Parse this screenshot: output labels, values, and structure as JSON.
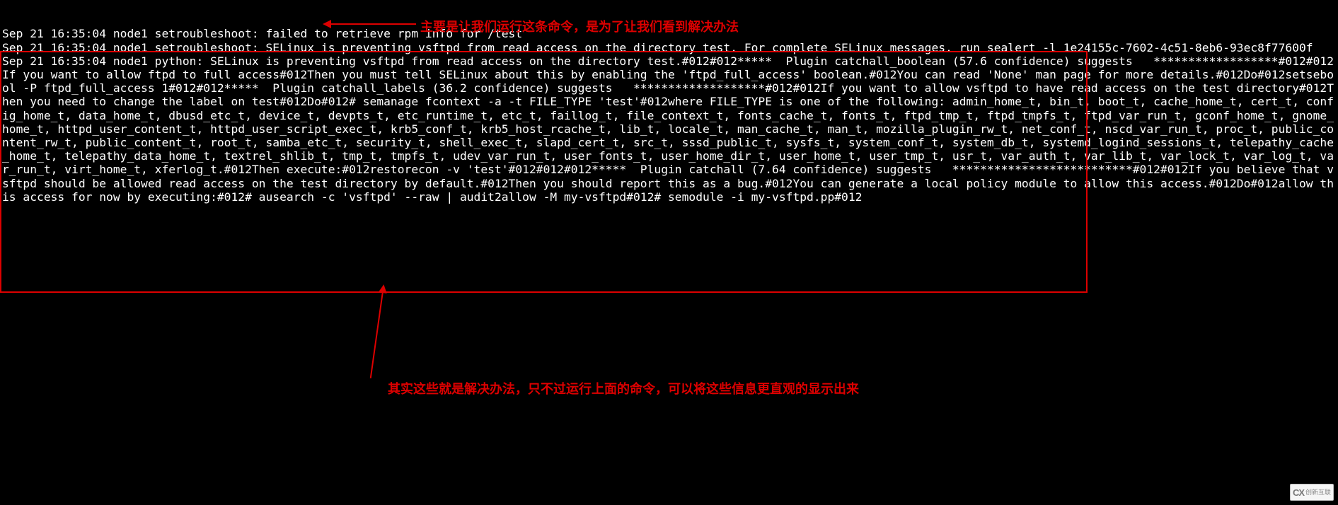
{
  "annotations": {
    "a1": "主要是让我们运行这条命令，是为了让我们看到解决办法",
    "a2": "其实这些就是解决办法，只不过运行上面的命令，可以将这些信息更直观的显示出来"
  },
  "watermark": {
    "brand": "CX",
    "text": "创新互联"
  },
  "log_lines": [
    "Sep 21 16:35:04 node1 setroubleshoot: failed to retrieve rpm info for /test",
    "Sep 21 16:35:04 node1 setroubleshoot: SELinux is preventing vsftpd from read access on the directory test. For complete SELinux messages. run sealert -l 1e24155c-7602-4c51-8eb6-93ec8f77600f",
    "Sep 21 16:35:04 node1 python: SELinux is preventing vsftpd from read access on the directory test.#012#012*****  Plugin catchall_boolean (57.6 confidence) suggests   ******************#012#012If you want to allow ftpd to full access#012Then you must tell SELinux about this by enabling the 'ftpd_full_access' boolean.#012You can read 'None' man page for more details.#012Do#012setsebool -P ftpd_full_access 1#012#012*****  Plugin catchall_labels (36.2 confidence) suggests   *******************#012#012If you want to allow vsftpd to have read access on the test directory#012Then you need to change the label on test#012Do#012# semanage fcontext -a -t FILE_TYPE 'test'#012where FILE_TYPE is one of the following: admin_home_t, bin_t, boot_t, cache_home_t, cert_t, config_home_t, data_home_t, dbusd_etc_t, device_t, devpts_t, etc_runtime_t, etc_t, faillog_t, file_context_t, fonts_cache_t, fonts_t, ftpd_tmp_t, ftpd_tmpfs_t, ftpd_var_run_t, gconf_home_t, gnome_home_t, httpd_user_content_t, httpd_user_script_exec_t, krb5_conf_t, krb5_host_rcache_t, lib_t, locale_t, man_cache_t, man_t, mozilla_plugin_rw_t, net_conf_t, nscd_var_run_t, proc_t, public_content_rw_t, public_content_t, root_t, samba_etc_t, security_t, shell_exec_t, slapd_cert_t, src_t, sssd_public_t, sysfs_t, system_conf_t, system_db_t, systemd_logind_sessions_t, telepathy_cache_home_t, telepathy_data_home_t, textrel_shlib_t, tmp_t, tmpfs_t, udev_var_run_t, user_fonts_t, user_home_dir_t, user_home_t, user_tmp_t, usr_t, var_auth_t, var_lib_t, var_lock_t, var_log_t, var_run_t, virt_home_t, xferlog_t.#012Then execute:#012restorecon -v 'test'#012#012#012*****  Plugin catchall (7.64 confidence) suggests   **************************#012#012If you believe that vsftpd should be allowed read access on the test directory by default.#012Then you should report this as a bug.#012You can generate a local policy module to allow this access.#012Do#012allow this access for now by executing:#012# ausearch -c 'vsftpd' --raw | audit2allow -M my-vsftpd#012# semodule -i my-vsftpd.pp#012"
  ]
}
